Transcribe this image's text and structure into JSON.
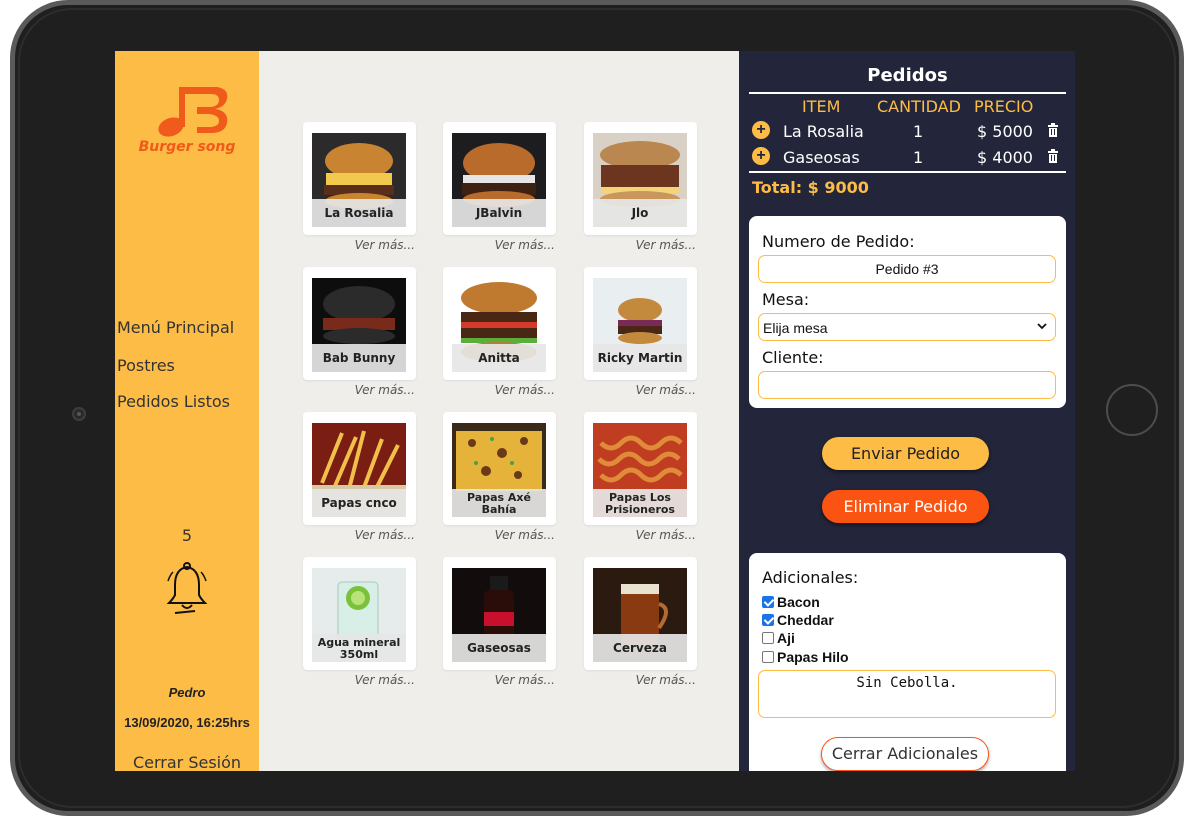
{
  "brand": {
    "name": "Burger song",
    "color": "#f05a1a"
  },
  "sidebar": {
    "nav": [
      {
        "label": "Menú Principal"
      },
      {
        "label": "Postres"
      },
      {
        "label": "Pedidos Listos"
      }
    ],
    "notification_count": "5",
    "notification_icon": "bell-icon",
    "user_name": "Pedro",
    "datetime": "13/09/2020, 16:25hrs",
    "logout_label": "Cerrar Sesión"
  },
  "products": [
    {
      "name": "La Rosalia",
      "more": "Ver más..."
    },
    {
      "name": "JBalvin",
      "more": "Ver más..."
    },
    {
      "name": "Jlo",
      "more": "Ver más..."
    },
    {
      "name": "Bab Bunny",
      "more": "Ver más..."
    },
    {
      "name": "Anitta",
      "more": "Ver más..."
    },
    {
      "name": "Ricky Martin",
      "more": "Ver más..."
    },
    {
      "name": "Papas cnco",
      "more": "Ver más..."
    },
    {
      "name": "Papas Axé Bahía",
      "more": "Ver más..."
    },
    {
      "name": "Papas Los Prisioneros",
      "more": "Ver más..."
    },
    {
      "name": "Agua mineral 350ml",
      "more": "Ver más..."
    },
    {
      "name": "Gaseosas",
      "more": "Ver más..."
    },
    {
      "name": "Cerveza",
      "more": "Ver más..."
    }
  ],
  "orders": {
    "title": "Pedidos",
    "columns": {
      "item": "ITEM",
      "quantity": "CANTIDAD",
      "price": "PRECIO"
    },
    "rows": [
      {
        "item": "La Rosalia",
        "quantity": "1",
        "price": "$ 5000"
      },
      {
        "item": "Gaseosas",
        "quantity": "1",
        "price": "$ 4000"
      }
    ],
    "total": "Total: $ 9000"
  },
  "order_form": {
    "order_number_label": "Numero de Pedido:",
    "order_number_value": "Pedido #3",
    "table_label": "Mesa:",
    "table_selected": "Elija mesa",
    "client_label": "Cliente:",
    "client_value": ""
  },
  "actions": {
    "send_label": "Enviar Pedido",
    "delete_label": "Eliminar Pedido"
  },
  "extras": {
    "title": "Adicionales:",
    "options": [
      {
        "label": "Bacon",
        "checked": true
      },
      {
        "label": "Cheddar",
        "checked": true
      },
      {
        "label": "Aji",
        "checked": false
      },
      {
        "label": "Papas Hilo",
        "checked": false
      }
    ],
    "note": "Sin Cebolla.",
    "close_label": "Cerrar Adicionales"
  },
  "colors": {
    "accent": "#fdbc46",
    "panel": "#23263a",
    "danger": "#fb5412"
  }
}
